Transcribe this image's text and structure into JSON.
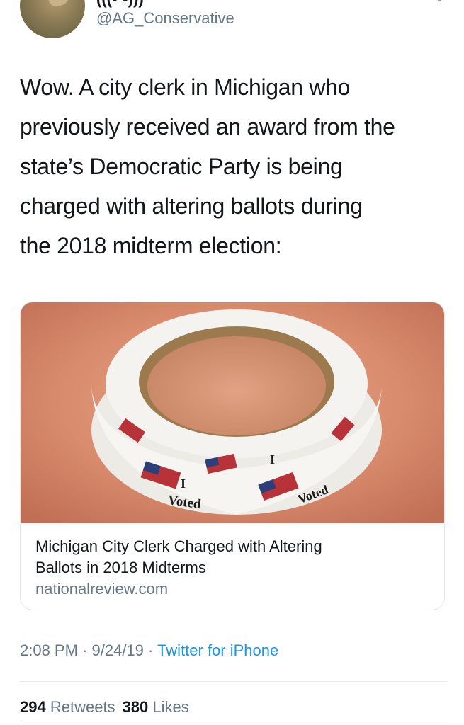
{
  "user": {
    "display_name": "(((•·•)))",
    "handle": "@AG_Conservative"
  },
  "tweet": {
    "text_lines": [
      "Wow. A city clerk in Michigan who",
      "previously received an award from the",
      "state’s Democratic Party is being",
      "charged with altering ballots during",
      "the 2018 midterm election:"
    ]
  },
  "card": {
    "title_lines": [
      "Michigan City Clerk Charged with Altering",
      "Ballots in 2018 Midterms"
    ],
    "domain": "nationalreview.com",
    "sticker_text_i": "I",
    "sticker_text_voted": "Voted"
  },
  "meta": {
    "time": "2:08 PM",
    "sep1": " · ",
    "date": "9/24/19",
    "sep2": " · ",
    "source": "Twitter for iPhone"
  },
  "stats": {
    "retweets_count": "294",
    "retweets_label": "Retweets",
    "likes_count": "380",
    "likes_label": "Likes"
  },
  "colors": {
    "link_blue": "#1b95e0",
    "secondary_gray": "#657786",
    "text_dark": "#14171a"
  }
}
